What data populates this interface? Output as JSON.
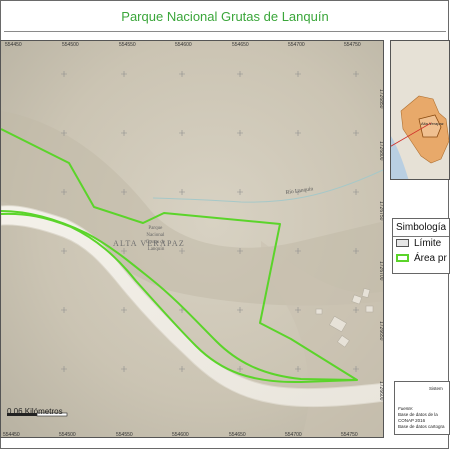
{
  "title": "Parque Nacional Grutas de Lanquín",
  "map": {
    "x_ticks": [
      "554450",
      "554500",
      "554550",
      "554600",
      "554650",
      "554700",
      "554750"
    ],
    "x_ticks_bottom": [
      "554450",
      "554500",
      "554550",
      "554600",
      "554650",
      "554700",
      "554750"
    ],
    "y_ticks": [
      "1726850",
      "1726800",
      "1726750",
      "1726700",
      "1726650",
      "1726600"
    ],
    "river_label": "Río Lanquín",
    "region_label": "ALTA VERAPAZ",
    "park_label": "Parque Nacional Grutas de Lanquín",
    "scale_label": "0.06 Kilómetros",
    "colors": {
      "terrain": "#cfc8b8",
      "boundary": "#5bd42a",
      "river": "#a6c8c8"
    }
  },
  "inset": {
    "label": "Alta Verapaz"
  },
  "legend": {
    "title": "Simbología",
    "items": [
      {
        "label": "Límite"
      },
      {
        "label": "Área pr"
      }
    ]
  },
  "info": {
    "header": "Sistem",
    "source_label": "Fuente:",
    "line1": "Base de datos de la",
    "line2": "CONAP 2016",
    "line3": "Base de datos cartogra"
  }
}
